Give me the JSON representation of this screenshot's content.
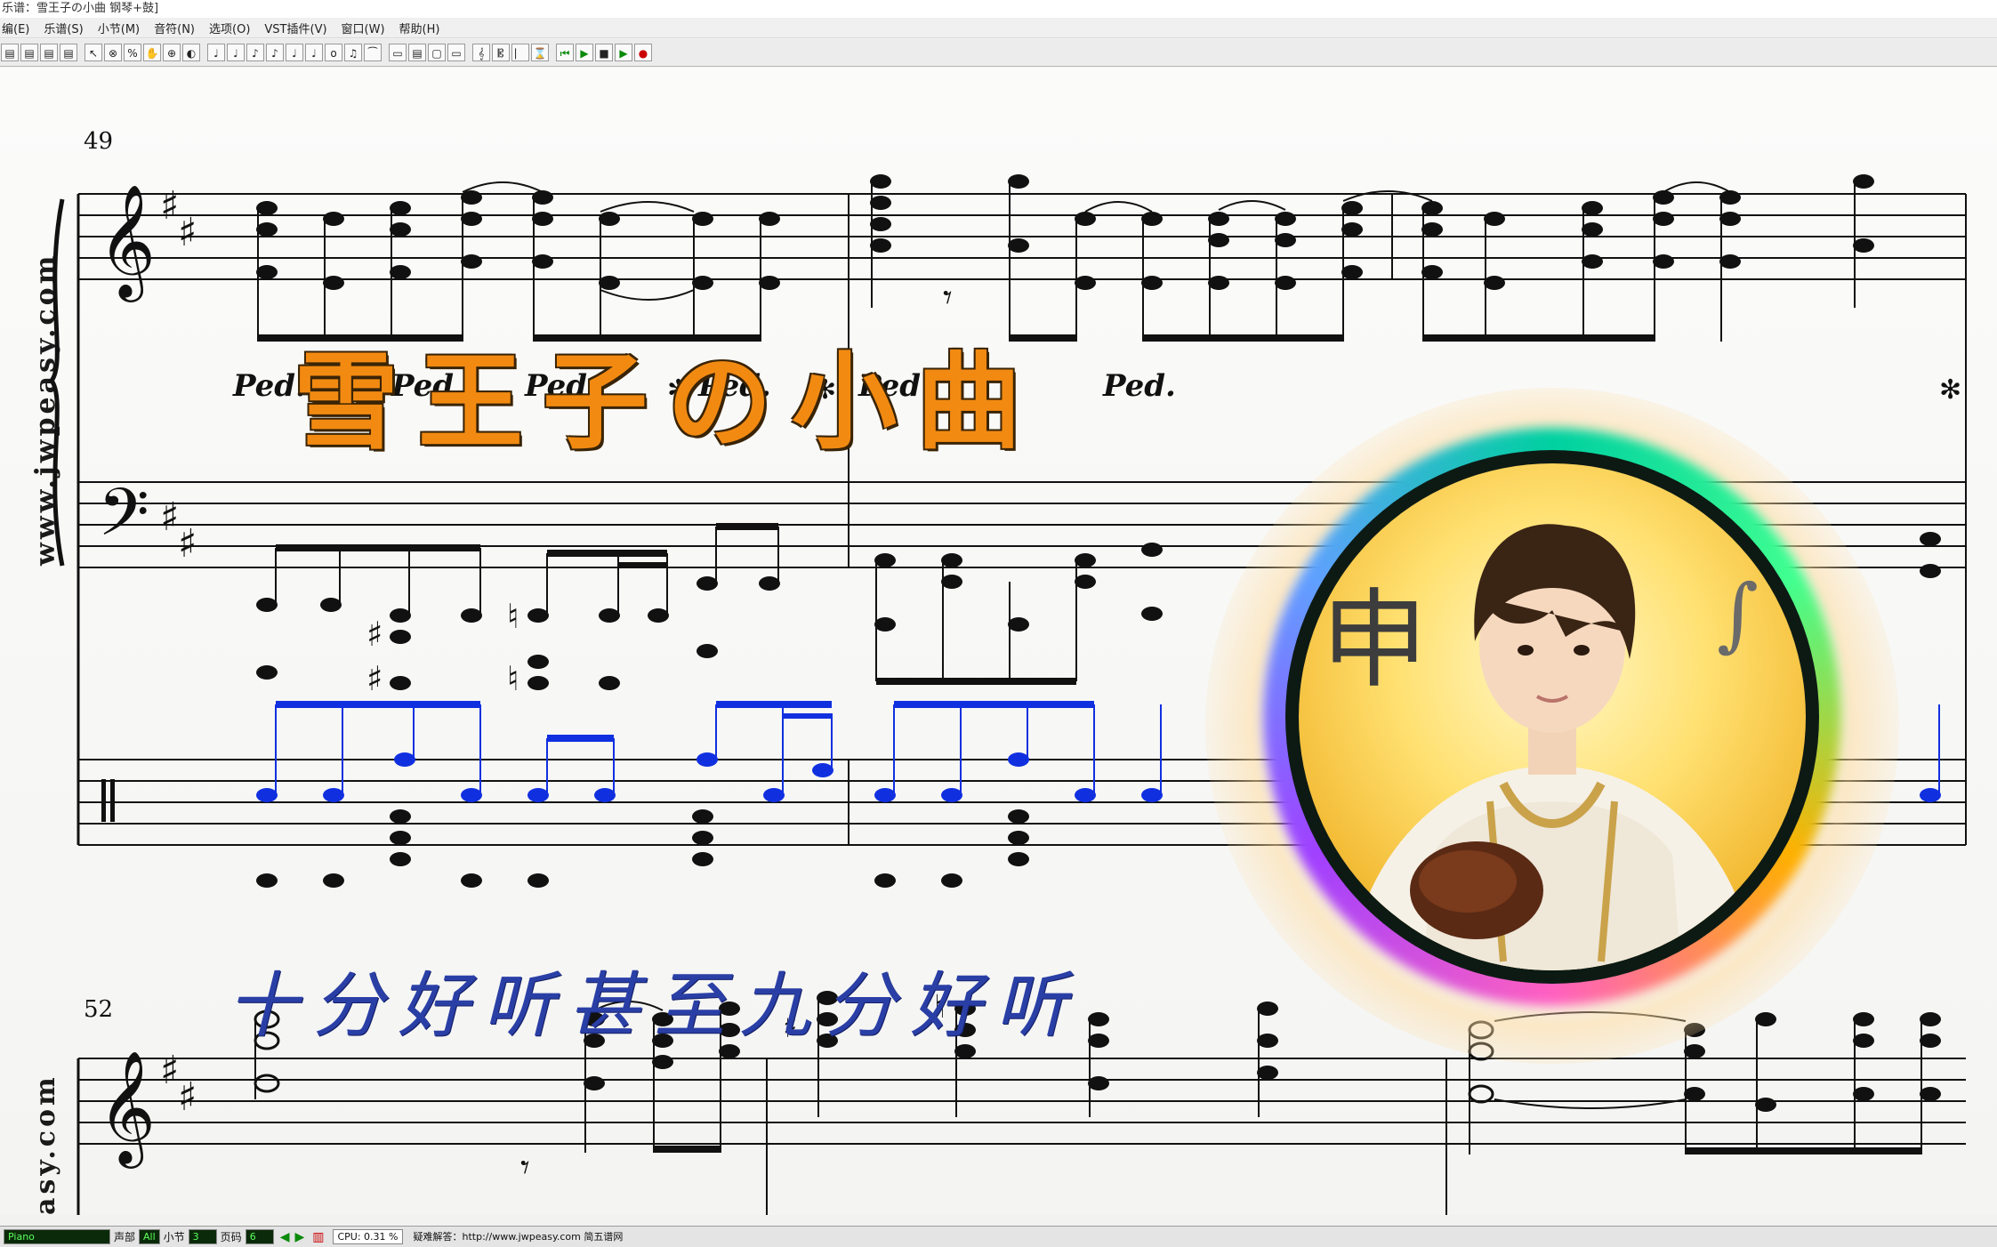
{
  "window": {
    "title": "乐谱：雪王子の小曲 钢琴+鼓]"
  },
  "menu": {
    "items": [
      "编(E)",
      "乐谱(S)",
      "小节(M)",
      "音符(N)",
      "选项(O)",
      "VST插件(V)",
      "窗口(W)",
      "帮助(H)"
    ]
  },
  "toolbar": {
    "buttons": [
      "▤",
      "▤",
      "▤",
      "▤",
      "↖",
      "⊗",
      "%",
      "✋",
      "⊕",
      "◐",
      "♩",
      "♩",
      "♪",
      "♪",
      "♩",
      "♩",
      "o",
      "♫",
      "⁀",
      "▭",
      "▤",
      "▢",
      "▭",
      "𝄞",
      "𝄡",
      "⎸",
      "⌛",
      "⏮",
      "▶",
      "■",
      "▶",
      "●"
    ]
  },
  "score": {
    "website": "www.jwpeasy.com",
    "website_partial": "asy.com",
    "measure_upper": "49",
    "measure_lower": "52",
    "title_overlay": "雪王子の小曲",
    "subtitle_overlay": "十分好听甚至九分好听",
    "pedal_marks": [
      "Ped.",
      "Ped.",
      "Ped.",
      "Ped.",
      "Ped.",
      "Ped."
    ]
  },
  "status": {
    "instrument": "Piano",
    "voice_label": "声部",
    "voice_value": "All",
    "measure_label": "小节",
    "measure_value": "3",
    "page_label": "页码",
    "page_value": "6",
    "cpu": "CPU: 0.31 %",
    "help": "疑难解答：http://www.jwpeasy.com 简五谱网"
  },
  "colors": {
    "title_orange": "#f28a12",
    "subtitle_blue": "#2a3fa6",
    "drum_blue": "#1030e0"
  }
}
